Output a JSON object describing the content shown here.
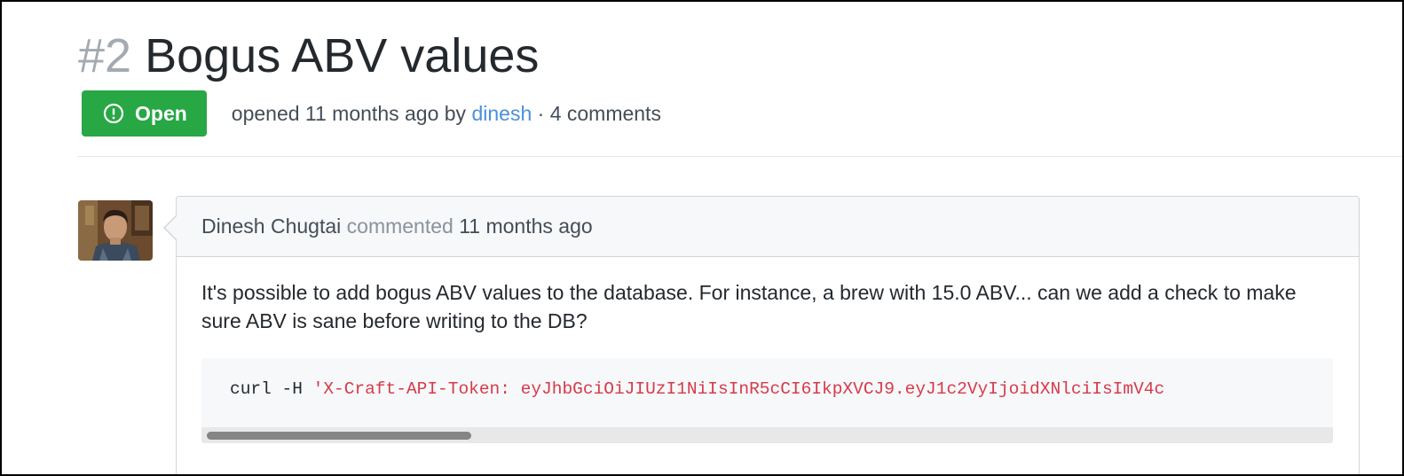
{
  "issue": {
    "number": "#2",
    "title": "Bogus ABV values",
    "state": "Open",
    "state_color": "#28a745",
    "state_icon": "issue-opened-icon",
    "meta": {
      "opened_prefix": "opened 11 months ago by",
      "author": "dinesh",
      "separator": "·",
      "comments": "4 comments"
    }
  },
  "comment": {
    "author": "Dinesh Chugtai",
    "verb": "commented",
    "time": "11 months ago",
    "body": "It's possible to add bogus ABV values to the database. For instance, a brew with 15.0 ABV... can we add a check to make sure ABV is sane before writing to the DB?",
    "code": {
      "command": "curl -H ",
      "string": "'X-Craft-API-Token: eyJhbGciOiJIUzI1NiIsInR5cCI6IkpXVCJ9.eyJ1c2VyIjoidXNlciIsImV4c"
    }
  },
  "colors": {
    "link": "#4a90d9",
    "code_string": "#d73a49",
    "muted": "#a3aab1"
  }
}
